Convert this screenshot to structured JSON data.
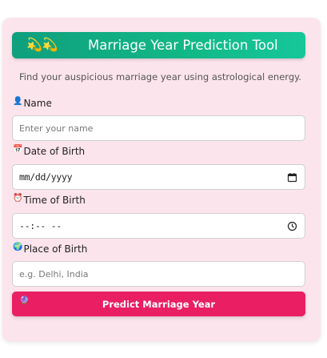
{
  "header": {
    "emoji": "💫💫",
    "title": "Marriage Year Prediction Tool"
  },
  "subtitle": "Find your auspicious marriage year using astrological energy.",
  "fields": {
    "name": {
      "icon": "👤",
      "label": "Name",
      "placeholder": "Enter your name"
    },
    "dob": {
      "icon": "📅",
      "label": "Date of Birth",
      "value": "mm/dd/yyyy"
    },
    "tob": {
      "icon": "⏰",
      "label": "Time of Birth",
      "value": "--:-- --"
    },
    "pob": {
      "icon": "🌍",
      "label": "Place of Birth",
      "placeholder": "e.g. Delhi, India"
    }
  },
  "button": {
    "icon": "🔮",
    "label": "Predict Marriage Year"
  },
  "colors": {
    "card_bg": "#fce4ec",
    "header_bg": "#12b886",
    "button_bg": "#e91e63"
  }
}
